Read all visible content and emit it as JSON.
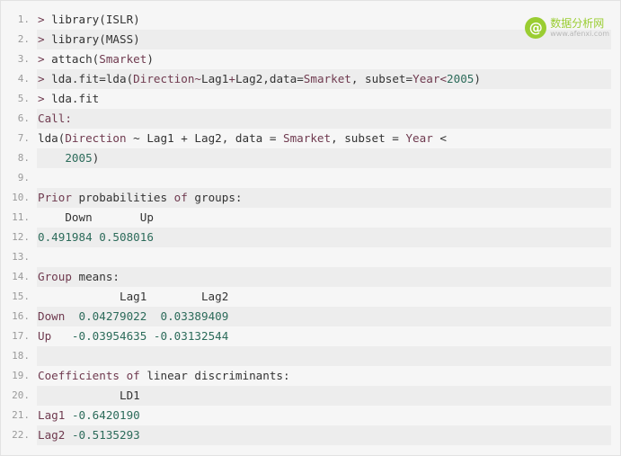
{
  "watermark": {
    "logo_glyph": "@",
    "title": "数据分析网",
    "subtitle": "www.afenxi.com"
  },
  "lines": [
    {
      "no": "1.",
      "tokens": [
        [
          "> ",
          "kw"
        ],
        [
          "library(ISLR)",
          "plain"
        ]
      ]
    },
    {
      "no": "2.",
      "tokens": [
        [
          "> ",
          "kw"
        ],
        [
          "library(MASS)",
          "plain"
        ]
      ]
    },
    {
      "no": "3.",
      "tokens": [
        [
          "> ",
          "kw"
        ],
        [
          "attach(",
          "plain"
        ],
        [
          "Smarket",
          "kw"
        ],
        [
          ")",
          "plain"
        ]
      ]
    },
    {
      "no": "4.",
      "tokens": [
        [
          "> ",
          "kw"
        ],
        [
          "lda.fit=lda(",
          "plain"
        ],
        [
          "Direction",
          "kw"
        ],
        [
          "~",
          "op"
        ],
        [
          "Lag1",
          "plain"
        ],
        [
          "+",
          "op"
        ],
        [
          "Lag2,data=",
          "plain"
        ],
        [
          "Smarket",
          "kw"
        ],
        [
          ", subset=",
          "plain"
        ],
        [
          "Year",
          "kw"
        ],
        [
          "<",
          "op"
        ],
        [
          "2005",
          "num"
        ],
        [
          ")",
          "plain"
        ]
      ]
    },
    {
      "no": "5.",
      "tokens": [
        [
          "> ",
          "kw"
        ],
        [
          "lda.fit",
          "plain"
        ]
      ]
    },
    {
      "no": "6.",
      "tokens": [
        [
          "Call:",
          "kw"
        ]
      ]
    },
    {
      "no": "7.",
      "tokens": [
        [
          "lda(",
          "plain"
        ],
        [
          "Direction",
          "kw"
        ],
        [
          " ~ Lag1 + Lag2, data = ",
          "plain"
        ],
        [
          "Smarket",
          "kw"
        ],
        [
          ", subset = ",
          "plain"
        ],
        [
          "Year",
          "kw"
        ],
        [
          " <",
          "plain"
        ]
      ]
    },
    {
      "no": "8.",
      "tokens": [
        [
          "    ",
          "plain"
        ],
        [
          "2005",
          "num"
        ],
        [
          ")",
          "plain"
        ]
      ]
    },
    {
      "no": "9.",
      "tokens": []
    },
    {
      "no": "10.",
      "tokens": [
        [
          "Prior",
          "kw"
        ],
        [
          " probabilities ",
          "plain"
        ],
        [
          "of",
          "kw"
        ],
        [
          " groups:",
          "plain"
        ]
      ]
    },
    {
      "no": "11.",
      "tokens": [
        [
          "    Down       Up",
          "plain"
        ]
      ]
    },
    {
      "no": "12.",
      "tokens": [
        [
          "0.491984 0.508016",
          "num"
        ]
      ]
    },
    {
      "no": "13.",
      "tokens": []
    },
    {
      "no": "14.",
      "tokens": [
        [
          "Group",
          "kw"
        ],
        [
          " means:",
          "plain"
        ]
      ]
    },
    {
      "no": "15.",
      "tokens": [
        [
          "            Lag1        Lag2",
          "plain"
        ]
      ]
    },
    {
      "no": "16.",
      "tokens": [
        [
          "Down",
          "kw"
        ],
        [
          "  ",
          "plain"
        ],
        [
          "0.04279022  0.03389409",
          "num"
        ]
      ]
    },
    {
      "no": "17.",
      "tokens": [
        [
          "Up",
          "kw"
        ],
        [
          "   ",
          "plain"
        ],
        [
          "-0.03954635 -0.03132544",
          "num"
        ]
      ]
    },
    {
      "no": "18.",
      "tokens": []
    },
    {
      "no": "19.",
      "tokens": [
        [
          "Coefficients",
          "kw"
        ],
        [
          " ",
          "plain"
        ],
        [
          "of",
          "kw"
        ],
        [
          " linear discriminants:",
          "plain"
        ]
      ]
    },
    {
      "no": "20.",
      "tokens": [
        [
          "            LD1",
          "plain"
        ]
      ]
    },
    {
      "no": "21.",
      "tokens": [
        [
          "Lag1",
          "kw"
        ],
        [
          " ",
          "plain"
        ],
        [
          "-0.6420190",
          "num"
        ]
      ]
    },
    {
      "no": "22.",
      "tokens": [
        [
          "Lag2",
          "kw"
        ],
        [
          " ",
          "plain"
        ],
        [
          "-0.5135293",
          "num"
        ]
      ]
    }
  ]
}
